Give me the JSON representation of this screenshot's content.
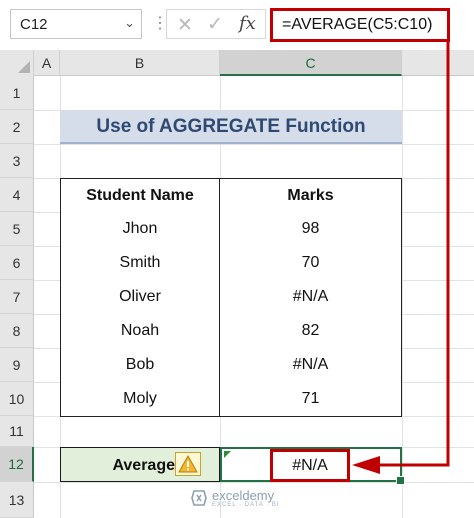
{
  "formula_bar": {
    "name_box": "C12",
    "formula": "=AVERAGE(C5:C10)",
    "fx_label": "fx",
    "icons": [
      "chevron-down-icon",
      "more-options-icon",
      "cancel-x-icon",
      "check-icon",
      "fx-icon"
    ]
  },
  "columns": [
    "A",
    "B",
    "C"
  ],
  "rows": [
    "1",
    "2",
    "3",
    "4",
    "5",
    "6",
    "7",
    "8",
    "9",
    "10",
    "11",
    "12",
    "13"
  ],
  "sheet": {
    "title": "Use of AGGREGATE Function",
    "headers": [
      "Student Name",
      "Marks"
    ],
    "students": [
      {
        "name": "Jhon",
        "marks": "98"
      },
      {
        "name": "Smith",
        "marks": "70"
      },
      {
        "name": "Oliver",
        "marks": "#N/A"
      },
      {
        "name": "Noah",
        "marks": "82"
      },
      {
        "name": "Bob",
        "marks": "#N/A"
      },
      {
        "name": "Moly",
        "marks": "71"
      }
    ],
    "average_label": "Average",
    "average_value": "#N/A"
  },
  "watermark": {
    "name": "exceldemy",
    "tagline": "EXCEL · DATA · BI"
  },
  "colors": {
    "highlight_red": "#c00000",
    "excel_green": "#217346",
    "title_fill": "#d5dcea",
    "average_fill": "#e2efda"
  }
}
